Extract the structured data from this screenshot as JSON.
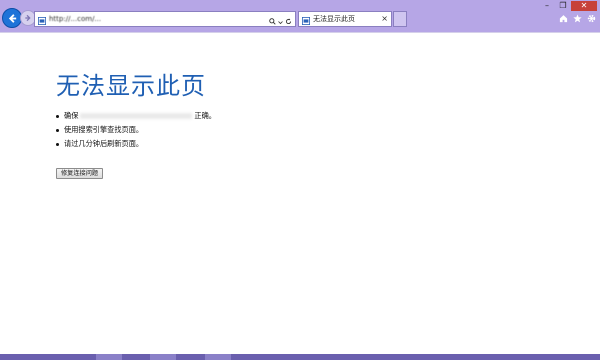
{
  "browser": {
    "address_url": "http://...com/...",
    "tab": {
      "title": "无法显示此页",
      "close_label": "×"
    },
    "window_controls": {
      "minimize": "–",
      "restore": "❐",
      "close": "✕"
    },
    "accent": "#1e73d8",
    "chrome_color": "#b6a6e6"
  },
  "page": {
    "title": "无法显示此页",
    "bullets": [
      {
        "prefix": "确保",
        "suffix": "正确。"
      },
      {
        "text": "使用搜索引擎查找页面。"
      },
      {
        "text": "请过几分钟后刷新页面。"
      }
    ],
    "diagnose_button": "修复连接问题"
  }
}
